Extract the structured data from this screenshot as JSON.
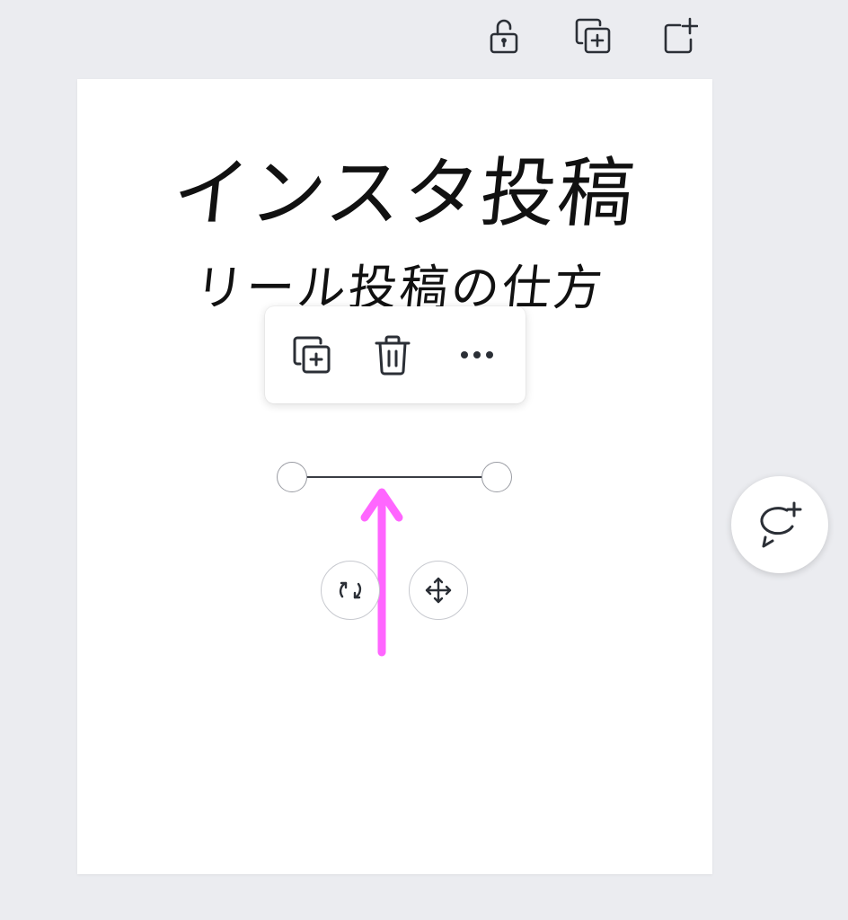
{
  "toolbar_top": {
    "icons": [
      "unlock-icon",
      "duplicate-page-icon",
      "add-page-icon"
    ]
  },
  "canvas": {
    "title": "インスタ投稿",
    "subtitle": "リール投稿の仕方"
  },
  "context_toolbar": {
    "icons": [
      "duplicate-icon",
      "trash-icon",
      "more-icon"
    ]
  },
  "element_controls": {
    "icons": [
      "rotate-icon",
      "move-icon"
    ]
  },
  "comment": {
    "icon": "add-comment-icon"
  },
  "colors": {
    "background": "#ebecf0",
    "page": "#ffffff",
    "annotation_arrow": "#ff66ff",
    "icon": "#2b2f36"
  }
}
